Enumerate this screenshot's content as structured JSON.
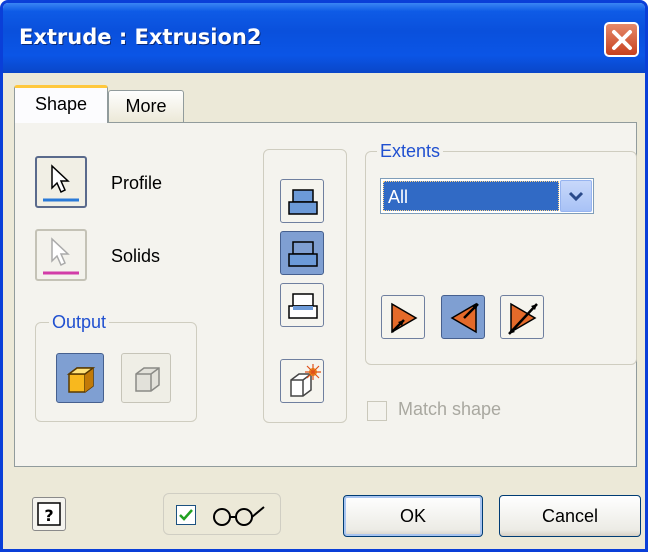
{
  "window": {
    "title": "Extrude : Extrusion2"
  },
  "tabs": [
    {
      "label": "Shape",
      "active": true
    },
    {
      "label": "More",
      "active": false
    }
  ],
  "selectors": {
    "profile_label": "Profile",
    "solids_label": "Solids"
  },
  "output": {
    "legend": "Output",
    "options": [
      {
        "icon": "solid-cube-icon",
        "selected": true
      },
      {
        "icon": "surface-cube-icon",
        "selected": false
      }
    ]
  },
  "operations": [
    {
      "icon": "join-icon",
      "selected": false
    },
    {
      "icon": "cut-icon",
      "selected": true
    },
    {
      "icon": "intersect-icon",
      "selected": false
    },
    {
      "icon": "new-solid-icon",
      "selected": false
    }
  ],
  "extents": {
    "legend": "Extents",
    "selected": "All",
    "directions": [
      {
        "icon": "direction-1-icon",
        "selected": false
      },
      {
        "icon": "direction-2-icon",
        "selected": true
      },
      {
        "icon": "symmetric-icon",
        "selected": false
      }
    ]
  },
  "match_shape": {
    "label": "Match shape",
    "checked": false,
    "enabled": false
  },
  "preview": {
    "checked": true,
    "icon": "glasses-icon"
  },
  "buttons": {
    "ok": "OK",
    "cancel": "Cancel",
    "help_icon": "help-icon"
  },
  "colors": {
    "titlebar": "#0a50dc",
    "selected_button": "#7f9fd2",
    "legend_text": "#2050d0",
    "dropdown_highlight": "#316ac5"
  }
}
